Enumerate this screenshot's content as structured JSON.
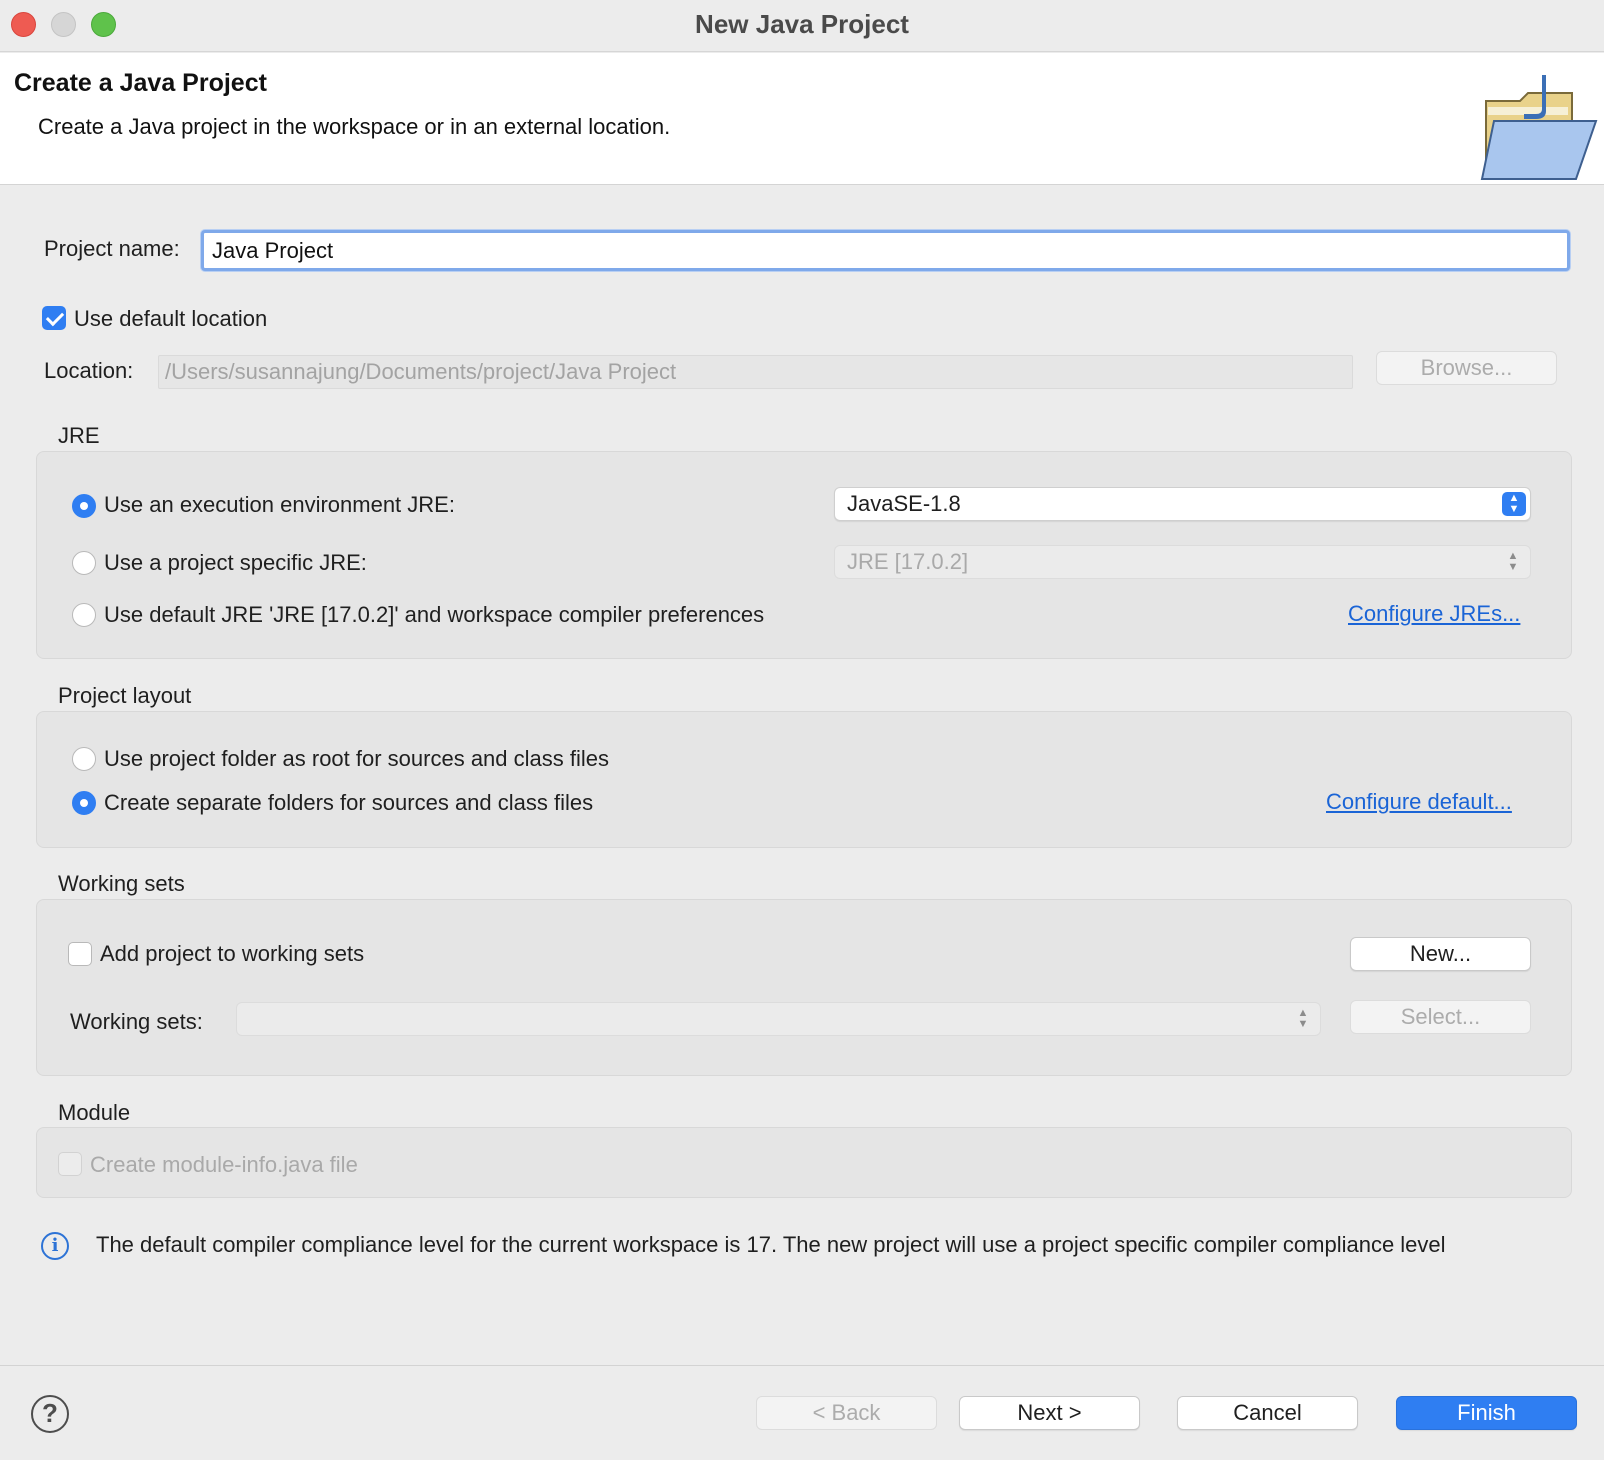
{
  "window": {
    "title": "New Java Project"
  },
  "header": {
    "title": "Create a Java Project",
    "description": "Create a Java project in the workspace or in an external location.",
    "icon": "java-project-folder-icon"
  },
  "project_name": {
    "label": "Project name:",
    "value": "Java Project"
  },
  "location": {
    "use_default_label": "Use default location",
    "use_default_checked": true,
    "label": "Location:",
    "value": "/Users/susannajung/Documents/project/Java Project",
    "browse_label": "Browse..."
  },
  "jre": {
    "group_label": "JRE",
    "options": [
      {
        "label": "Use an execution environment JRE:",
        "selected": true
      },
      {
        "label": "Use a project specific JRE:",
        "selected": false
      },
      {
        "label": "Use default JRE 'JRE [17.0.2]' and workspace compiler preferences",
        "selected": false
      }
    ],
    "execution_env_value": "JavaSE-1.8",
    "project_specific_value": "JRE [17.0.2]",
    "configure_link": "Configure JREs..."
  },
  "layout": {
    "group_label": "Project layout",
    "options": [
      {
        "label": "Use project folder as root for sources and class files",
        "selected": false
      },
      {
        "label": "Create separate folders for sources and class files",
        "selected": true
      }
    ],
    "configure_link": "Configure default..."
  },
  "working_sets": {
    "group_label": "Working sets",
    "add_label": "Add project to working sets",
    "add_checked": false,
    "new_label": "New...",
    "sets_label": "Working sets:",
    "sets_value": "",
    "select_label": "Select..."
  },
  "module": {
    "group_label": "Module",
    "create_label": "Create module-info.java file",
    "create_checked": false
  },
  "info": {
    "message": "The default compiler compliance level for the current workspace is 17. The new project will use a project specific compiler compliance level"
  },
  "footer": {
    "help": "?",
    "back_label": "< Back",
    "next_label": "Next >",
    "cancel_label": "Cancel",
    "finish_label": "Finish"
  },
  "colors": {
    "accent": "#2f7ef2",
    "link": "#1a64d6"
  }
}
